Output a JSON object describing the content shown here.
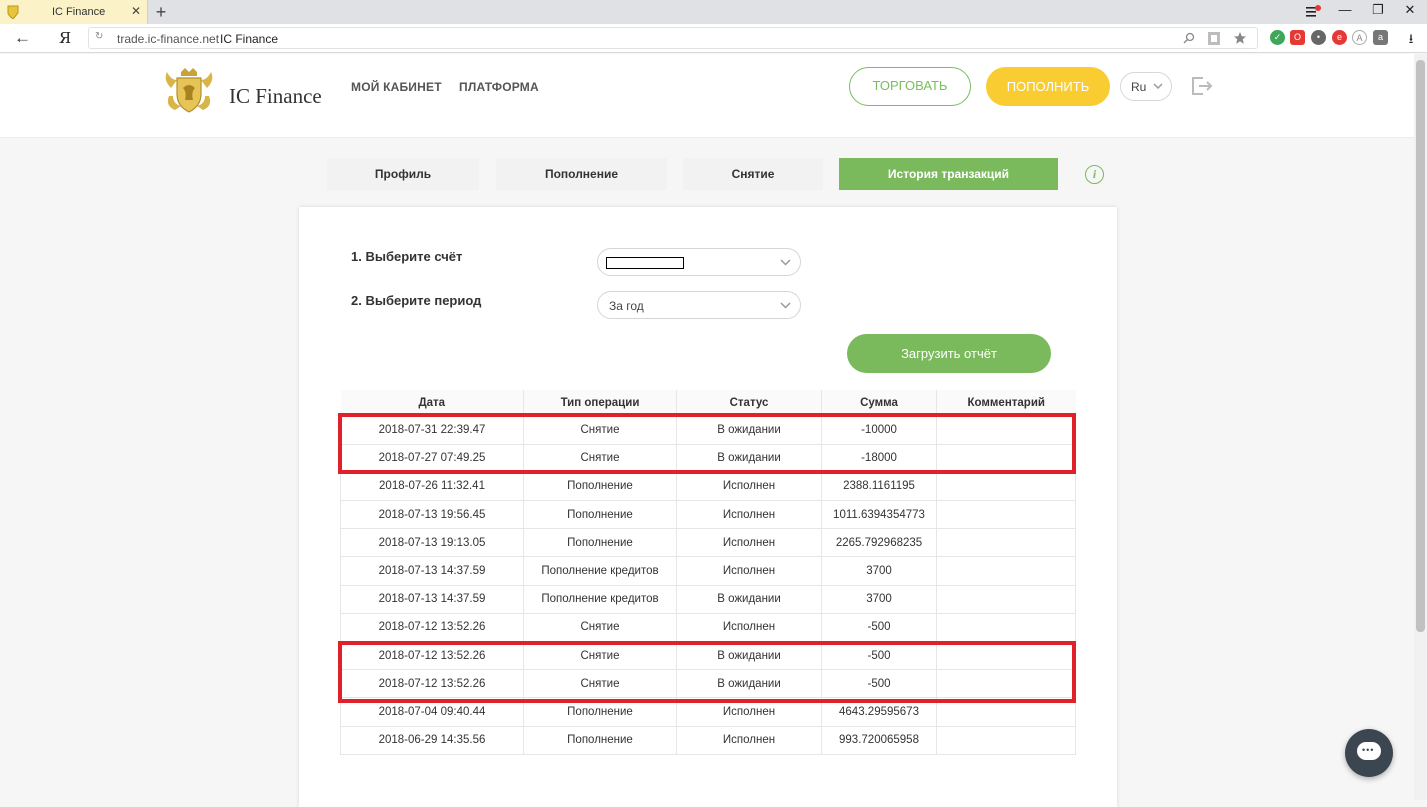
{
  "browser": {
    "tab_title": "IC Finance",
    "tab_close": "✕",
    "new_tab": "+",
    "back": "←",
    "yandex": "Я",
    "reload": "↻",
    "url_domain": "trade.ic-finance.net",
    "url_title": "IC Finance",
    "minimize": "—",
    "restore": "❐",
    "close": "✕",
    "download": "⭳"
  },
  "header": {
    "logo_text": "IC Finance",
    "nav": [
      "МОЙ КАБИНЕТ",
      "ПЛАТФОРМА"
    ],
    "trade_label": "ТОРГОВАТЬ",
    "deposit_label": "ПОПОЛНИТЬ",
    "lang": "Ru"
  },
  "tabs": [
    {
      "label": "Профиль",
      "active": false
    },
    {
      "label": "Пополнение",
      "active": false
    },
    {
      "label": "Снятие",
      "active": false
    },
    {
      "label": "История транзакций",
      "active": true
    }
  ],
  "info_icon": "i",
  "form": {
    "account_label": "1. Выберите счёт",
    "period_label": "2. Выберите период",
    "period_value": "За год",
    "report_button": "Загрузить отчёт"
  },
  "table": {
    "headers": [
      "Дата",
      "Тип операции",
      "Статус",
      "Сумма",
      "Комментарий"
    ],
    "rows": [
      [
        "2018-07-31 22:39.47",
        "Снятие",
        "В ожидании",
        "-10000",
        ""
      ],
      [
        "2018-07-27 07:49.25",
        "Снятие",
        "В ожидании",
        "-18000",
        ""
      ],
      [
        "2018-07-26 11:32.41",
        "Пополнение",
        "Исполнен",
        "2388.1161195",
        ""
      ],
      [
        "2018-07-13 19:56.45",
        "Пополнение",
        "Исполнен",
        "1011.6394354773",
        ""
      ],
      [
        "2018-07-13 19:13.05",
        "Пополнение",
        "Исполнен",
        "2265.792968235",
        ""
      ],
      [
        "2018-07-13 14:37.59",
        "Пополнение кредитов",
        "Исполнен",
        "3700",
        ""
      ],
      [
        "2018-07-13 14:37.59",
        "Пополнение кредитов",
        "В ожидании",
        "3700",
        ""
      ],
      [
        "2018-07-12 13:52.26",
        "Снятие",
        "Исполнен",
        "-500",
        ""
      ],
      [
        "2018-07-12 13:52.26",
        "Снятие",
        "В ожидании",
        "-500",
        ""
      ],
      [
        "2018-07-12 13:52.26",
        "Снятие",
        "В ожидании",
        "-500",
        ""
      ],
      [
        "2018-07-04 09:40.44",
        "Пополнение",
        "Исполнен",
        "4643.29595673",
        ""
      ],
      [
        "2018-06-29 14:35.56",
        "Пополнение",
        "Исполнен",
        "993.720065958",
        ""
      ]
    ]
  },
  "colors": {
    "accent_green": "#7ab95c",
    "accent_yellow": "#f9cd32",
    "highlight_red": "#e0202b"
  }
}
